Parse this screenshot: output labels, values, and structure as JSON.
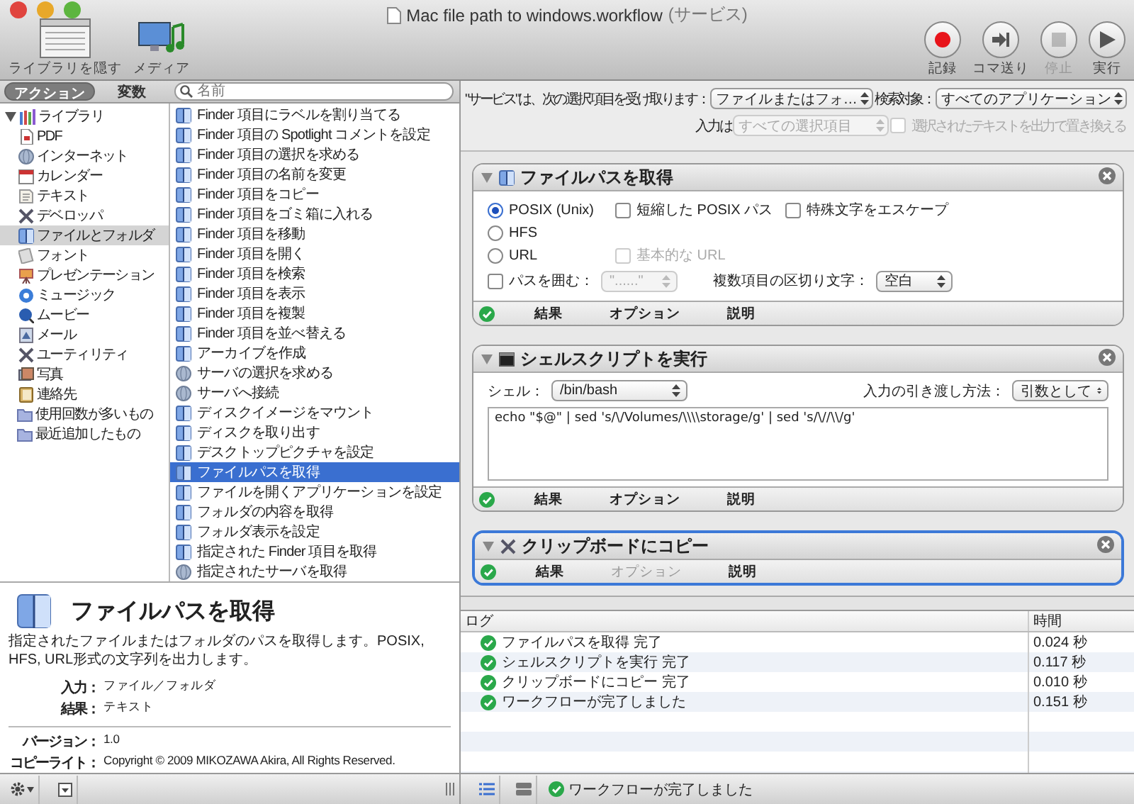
{
  "window": {
    "title": "Mac file path to windows.workflow",
    "subtitle": "(サービス)"
  },
  "toolbar_left": [
    {
      "label": "ライブラリを隠す",
      "kind": "library"
    },
    {
      "label": "メディア",
      "kind": "media"
    }
  ],
  "toolbar_right": [
    {
      "label": "記録",
      "kind": "record",
      "disabled": false
    },
    {
      "label": "コマ送り",
      "kind": "step",
      "disabled": false
    },
    {
      "label": "停止",
      "kind": "stop",
      "disabled": true
    },
    {
      "label": "実行",
      "kind": "run",
      "disabled": false
    }
  ],
  "library_tabs": [
    {
      "label": "アクション",
      "selected": true
    },
    {
      "label": "変数",
      "selected": false
    }
  ],
  "search": {
    "placeholder": "名前"
  },
  "library_tree": [
    {
      "label": "ライブラリ",
      "kind": "library",
      "expanded": true,
      "selected": false,
      "children": [
        {
          "label": "PDF",
          "kind": "doc",
          "selected": false
        },
        {
          "label": "インターネット",
          "kind": "globe",
          "selected": false
        },
        {
          "label": "カレンダー",
          "kind": "calendar",
          "selected": false
        },
        {
          "label": "テキスト",
          "kind": "text",
          "selected": false
        },
        {
          "label": "デベロッパ",
          "kind": "tools",
          "selected": false
        },
        {
          "label": "ファイルとフォルダ",
          "kind": "finder",
          "selected": true
        },
        {
          "label": "フォント",
          "kind": "font",
          "selected": false
        },
        {
          "label": "プレゼンテーション",
          "kind": "presentation",
          "selected": false
        },
        {
          "label": "ミュージック",
          "kind": "music",
          "selected": false
        },
        {
          "label": "ムービー",
          "kind": "movie",
          "selected": false
        },
        {
          "label": "メール",
          "kind": "mail",
          "selected": false
        },
        {
          "label": "ユーティリティ",
          "kind": "tools",
          "selected": false
        },
        {
          "label": "写真",
          "kind": "photo",
          "selected": false
        },
        {
          "label": "連絡先",
          "kind": "contacts",
          "selected": false
        }
      ]
    },
    {
      "label": "使用回数が多いもの",
      "kind": "folder",
      "selected": false
    },
    {
      "label": "最近追加したもの",
      "kind": "folder",
      "selected": false
    }
  ],
  "actions": [
    {
      "label": "Finder 項目にラベルを割り当てる",
      "kind": "finder",
      "selected": false
    },
    {
      "label": "Finder 項目の Spotlight コメントを設定",
      "kind": "finder",
      "selected": false
    },
    {
      "label": "Finder 項目の選択を求める",
      "kind": "finder",
      "selected": false
    },
    {
      "label": "Finder 項目の名前を変更",
      "kind": "finder",
      "selected": false
    },
    {
      "label": "Finder 項目をコピー",
      "kind": "finder",
      "selected": false
    },
    {
      "label": "Finder 項目をゴミ箱に入れる",
      "kind": "finder",
      "selected": false
    },
    {
      "label": "Finder 項目を移動",
      "kind": "finder",
      "selected": false
    },
    {
      "label": "Finder 項目を開く",
      "kind": "finder",
      "selected": false
    },
    {
      "label": "Finder 項目を検索",
      "kind": "finder",
      "selected": false
    },
    {
      "label": "Finder 項目を表示",
      "kind": "finder",
      "selected": false
    },
    {
      "label": "Finder 項目を複製",
      "kind": "finder",
      "selected": false
    },
    {
      "label": "Finder 項目を並べ替える",
      "kind": "finder",
      "selected": false
    },
    {
      "label": "アーカイブを作成",
      "kind": "finder",
      "selected": false
    },
    {
      "label": "サーバの選択を求める",
      "kind": "globe",
      "selected": false
    },
    {
      "label": "サーバへ接続",
      "kind": "globe",
      "selected": false
    },
    {
      "label": "ディスクイメージをマウント",
      "kind": "finder",
      "selected": false
    },
    {
      "label": "ディスクを取り出す",
      "kind": "finder",
      "selected": false
    },
    {
      "label": "デスクトップピクチャを設定",
      "kind": "finder",
      "selected": false
    },
    {
      "label": "ファイルパスを取得",
      "kind": "finder",
      "selected": true
    },
    {
      "label": "ファイルを開くアプリケーションを設定",
      "kind": "finder",
      "selected": false
    },
    {
      "label": "フォルダの内容を取得",
      "kind": "finder",
      "selected": false
    },
    {
      "label": "フォルダ表示を設定",
      "kind": "finder",
      "selected": false
    },
    {
      "label": "指定された Finder 項目を取得",
      "kind": "finder",
      "selected": false
    },
    {
      "label": "指定されたサーバを取得",
      "kind": "globe",
      "selected": false
    }
  ],
  "description": {
    "title": "ファイルパスを取得",
    "text": "指定されたファイルまたはフォルダのパスを取得します。POSIX, HFS, URL形式の文字列を出力します。",
    "fields": [
      {
        "label": "入力：",
        "value": "ファイル／フォルダ"
      },
      {
        "label": "結果：",
        "value": "テキスト"
      }
    ],
    "meta": [
      {
        "label": "バージョン：",
        "value": "1.0"
      },
      {
        "label": "コピーライト：",
        "value": "Copyright © 2009 MIKOZAWA Akira, All Rights Reserved."
      }
    ]
  },
  "service": {
    "label": "\"サービス\"は、次の選択項目を受け取ります：",
    "receives": "ファイルまたはフォ…",
    "target_label": "検索対象：",
    "target": "すべてのアプリケーション",
    "input_label": "入力は",
    "input": "すべての選択項目",
    "input_disabled": true,
    "replace": {
      "label": "選択されたテキストを出力で置き換える",
      "checked": false,
      "disabled": true
    }
  },
  "workflow": [
    {
      "title": "ファイルパスを取得",
      "kind": "path",
      "selected": false,
      "radios": [
        {
          "label": "POSIX (Unix)",
          "selected": true
        },
        {
          "label": "HFS",
          "selected": false
        },
        {
          "label": "URL",
          "selected": false
        }
      ],
      "checks": [
        {
          "label": "短縮した POSIX パス",
          "checked": false,
          "disabled": false
        },
        {
          "label": "特殊文字をエスケープ",
          "checked": false,
          "disabled": false
        },
        {
          "label": "基本的な URL",
          "checked": false,
          "disabled": true
        },
        {
          "label": "パスを囲む：",
          "checked": false,
          "disabled": false
        }
      ],
      "quote": {
        "value": "\"......\"",
        "disabled": true
      },
      "separator_label": "複数項目の区切り文字：",
      "separator": "空白",
      "tabs": [
        {
          "label": "結果",
          "disabled": false
        },
        {
          "label": "オプション",
          "disabled": false
        },
        {
          "label": "説明",
          "disabled": false
        }
      ]
    },
    {
      "title": "シェルスクリプトを実行",
      "kind": "shell",
      "selected": false,
      "shell_label": "シェル：",
      "shell": "/bin/bash",
      "pass_label": "入力の引き渡し方法：",
      "pass": "引数として",
      "script": "echo \"$@\" | sed 's/\\/Volumes/\\\\\\\\storage/g' | sed 's/\\//\\\\/g'",
      "tabs": [
        {
          "label": "結果",
          "disabled": false
        },
        {
          "label": "オプション",
          "disabled": false
        },
        {
          "label": "説明",
          "disabled": false
        }
      ]
    },
    {
      "title": "クリップボードにコピー",
      "kind": "plain",
      "selected": true,
      "tabs": [
        {
          "label": "結果",
          "disabled": false
        },
        {
          "label": "オプション",
          "disabled": true
        },
        {
          "label": "説明",
          "disabled": false
        }
      ]
    }
  ],
  "log": {
    "columns": [
      "ログ",
      "時間"
    ],
    "rows": [
      {
        "message": "ファイルパスを取得 完了",
        "time": "0.024 秒"
      },
      {
        "message": "シェルスクリプトを実行 完了",
        "time": "0.117 秒"
      },
      {
        "message": "クリップボードにコピー 完了",
        "time": "0.010 秒"
      },
      {
        "message": "ワークフローが完了しました",
        "time": "0.151 秒"
      }
    ]
  },
  "status_bar": {
    "message": "ワークフローが完了しました"
  }
}
